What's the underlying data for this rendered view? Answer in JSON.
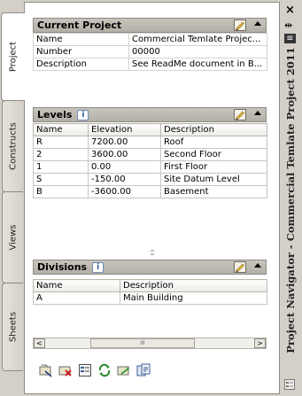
{
  "vertical_tabs": [
    "Project",
    "Constructs",
    "Views",
    "Sheets"
  ],
  "current_project": {
    "title": "Current Project",
    "rows": [
      {
        "label": "Name",
        "value": "Commercial Temlate Projec..."
      },
      {
        "label": "Number",
        "value": "00000"
      },
      {
        "label": "Description",
        "value": "See ReadMe document in B..."
      }
    ]
  },
  "levels": {
    "title": "Levels",
    "info_icon_text": "i",
    "columns": [
      "Name",
      "Elevation",
      "Description"
    ],
    "rows": [
      {
        "name": "R",
        "elevation": "7200.00",
        "description": "Roof"
      },
      {
        "name": "2",
        "elevation": "3600.00",
        "description": "Second Floor"
      },
      {
        "name": "1",
        "elevation": "0.00",
        "description": "First Floor"
      },
      {
        "name": "S",
        "elevation": "-150.00",
        "description": "Site Datum Level"
      },
      {
        "name": "B",
        "elevation": "-3600.00",
        "description": "Basement"
      }
    ]
  },
  "divisions": {
    "title": "Divisions",
    "info_icon_text": "i",
    "columns": [
      "Name",
      "Description"
    ],
    "rows": [
      {
        "name": "A",
        "description": "Main Building"
      }
    ],
    "scroll": {
      "left_arrow": "<",
      "right_arrow": ">",
      "thumb_grip": "III"
    }
  },
  "toolbar_icons": [
    "project-browser-icon",
    "close-project-icon",
    "project-properties-icon",
    "refresh-icon",
    "repath-project-icon",
    "project-standards-icon"
  ],
  "right_strip": {
    "close_glyph": "×",
    "auto_hide_glyph": "⇹",
    "properties_glyph": "≡",
    "title": "Project Navigator - Commercial Temlate Project 2011"
  },
  "colors": {
    "header_bg": "#bdbab2",
    "panel_bg": "#d4d0c8",
    "info_icon": "#2c5aa0"
  }
}
